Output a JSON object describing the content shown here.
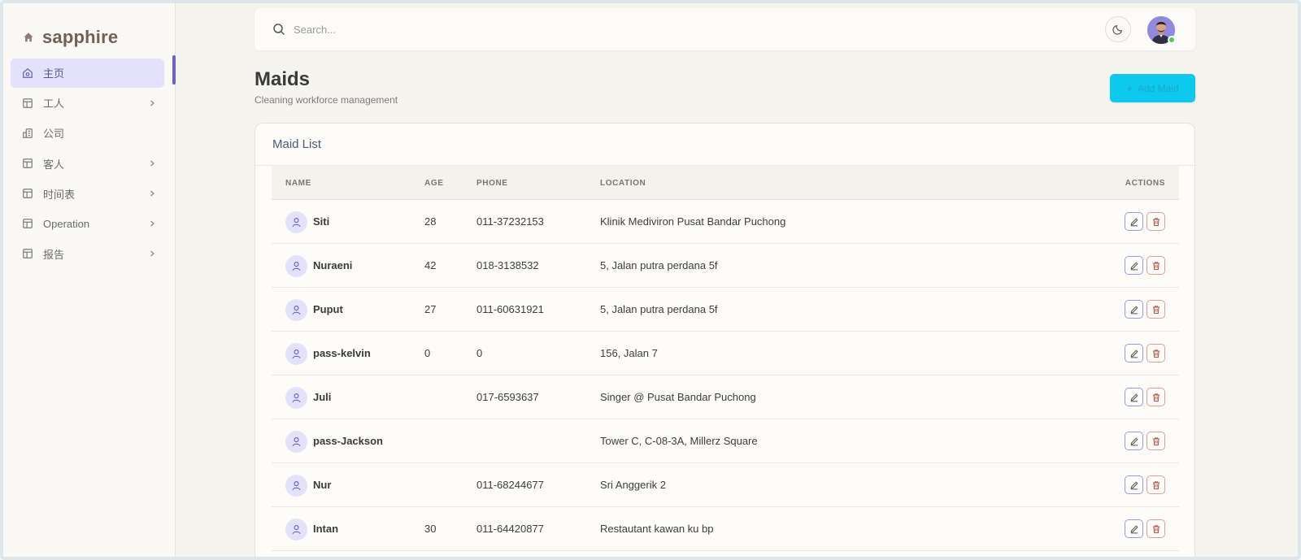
{
  "brand": {
    "name": "sapphire",
    "icon": "home-icon"
  },
  "sidebar": {
    "items": [
      {
        "label": "主页",
        "icon": "home-icon",
        "active": true,
        "has_children": false
      },
      {
        "label": "工人",
        "icon": "layout-icon",
        "active": false,
        "has_children": true
      },
      {
        "label": "公司",
        "icon": "building-icon",
        "active": false,
        "has_children": false
      },
      {
        "label": "客人",
        "icon": "layout-icon",
        "active": false,
        "has_children": true
      },
      {
        "label": "时间表",
        "icon": "layout-icon",
        "active": false,
        "has_children": true
      },
      {
        "label": "Operation",
        "icon": "layout-icon",
        "active": false,
        "has_children": true
      },
      {
        "label": "报告",
        "icon": "layout-icon",
        "active": false,
        "has_children": true
      }
    ]
  },
  "topbar": {
    "search": {
      "placeholder": "Search...",
      "value": ""
    },
    "theme_toggle_icon": "moon-icon",
    "avatar_status": "online"
  },
  "header": {
    "title": "Maids",
    "subtitle": "Cleaning workforce management",
    "add_button_label": "Add Maid"
  },
  "table": {
    "card_title": "Maid List",
    "columns": {
      "name": "NAME",
      "age": "AGE",
      "phone": "PHONE",
      "location": "LOCATION",
      "actions": "ACTIONS"
    },
    "rows": [
      {
        "name": "Siti",
        "age": "28",
        "phone": "011-37232153",
        "location": "Klinik Mediviron Pusat Bandar Puchong"
      },
      {
        "name": "Nuraeni",
        "age": "42",
        "phone": "018-3138532",
        "location": "5, Jalan putra perdana 5f"
      },
      {
        "name": "Puput",
        "age": "27",
        "phone": "011-60631921",
        "location": "5, Jalan putra perdana 5f"
      },
      {
        "name": "pass-kelvin",
        "age": "0",
        "phone": "0",
        "location": "156, Jalan 7"
      },
      {
        "name": "Juli",
        "age": "",
        "phone": "017-6593637",
        "location": "Singer @ Pusat Bandar Puchong"
      },
      {
        "name": "pass-Jackson",
        "age": "",
        "phone": "",
        "location": "Tower C, C-08-3A, Millerz Square"
      },
      {
        "name": "Nur",
        "age": "",
        "phone": "011-68244677",
        "location": "Sri Anggerik 2"
      },
      {
        "name": "Intan",
        "age": "30",
        "phone": "011-64420877",
        "location": "Restautant kawan ku bp"
      }
    ]
  },
  "colors": {
    "accent": "#6b63c9",
    "active_bg": "#e3e1fb",
    "add_button": "#0ec9ee",
    "edit_border": "#9d98dc",
    "delete_border": "#e09d93"
  }
}
